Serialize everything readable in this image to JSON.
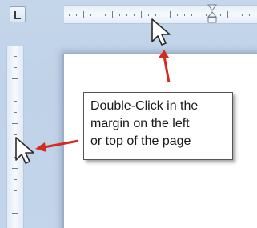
{
  "callout": {
    "lines": [
      "Double-Click in the",
      "margin on the left",
      "or top of the page"
    ]
  },
  "icons": {
    "tab_selector": "left-tab-icon",
    "cursor_top": "mouse-pointer-icon",
    "cursor_left": "mouse-pointer-icon",
    "arrow_top": "red-arrow-icon",
    "arrow_left": "red-arrow-icon",
    "indent_marker": "hourglass-indent-marker-icon"
  },
  "colors": {
    "workspace": "#c5d6ea",
    "ruler": "#f7fafd",
    "arrow": "#d42a20",
    "page": "#ffffff"
  }
}
